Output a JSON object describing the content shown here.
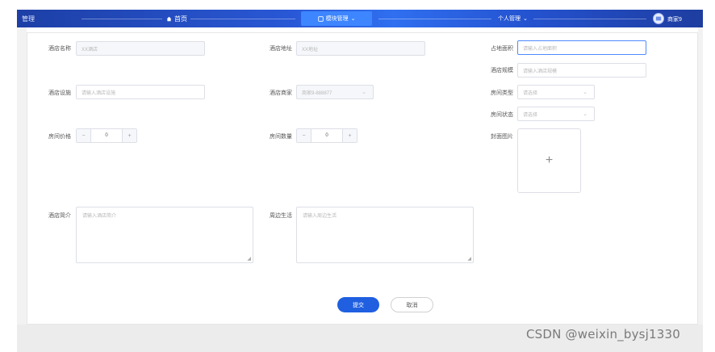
{
  "topbar": {
    "brand": "管理",
    "home": "首页",
    "module": "模块管理",
    "person": "个人管理",
    "user": "商家9"
  },
  "form": {
    "hotel_name": {
      "label": "酒店名称",
      "value": "XX酒店"
    },
    "hotel_address": {
      "label": "酒店地址",
      "value": "XX地址"
    },
    "area": {
      "label": "占地面积",
      "placeholder": "请输入占地面积"
    },
    "scale": {
      "label": "酒店规模",
      "placeholder": "请输入酒店规模"
    },
    "facilities": {
      "label": "酒店设施",
      "placeholder": "请输入酒店设施"
    },
    "merchant": {
      "label": "酒店商家",
      "value": "商家9-888877"
    },
    "room_type": {
      "label": "房间类型",
      "placeholder": "请选择"
    },
    "room_status": {
      "label": "房间状态",
      "placeholder": "请选择"
    },
    "room_price": {
      "label": "房间价格",
      "value": "0",
      "minus": "−",
      "plus": "+"
    },
    "room_count": {
      "label": "房间数量",
      "value": "0",
      "minus": "−",
      "plus": "+"
    },
    "cover": {
      "label": "封面图片",
      "plus": "+"
    },
    "intro": {
      "label": "酒店简介",
      "placeholder": "请输入酒店简介"
    },
    "nearby": {
      "label": "周边生活",
      "placeholder": "请输入周边生活"
    }
  },
  "actions": {
    "submit": "提交",
    "cancel": "取消"
  },
  "watermark": "CSDN @weixin_bysj1330"
}
